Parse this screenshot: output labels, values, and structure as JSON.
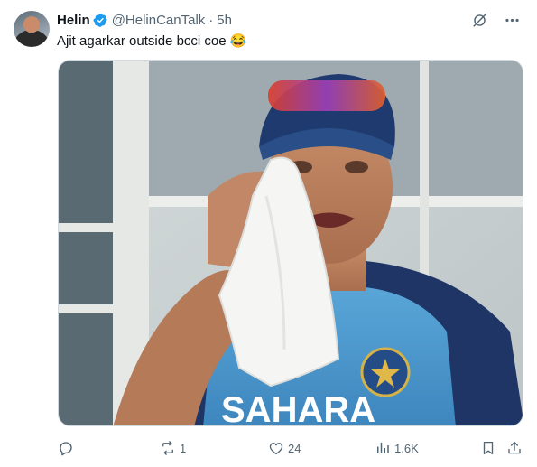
{
  "tweet": {
    "author_name": "Helin",
    "handle": "@HelinCanTalk",
    "separator": "·",
    "time": "5h",
    "text": "Ajit agarkar outside bcci coe 😂"
  },
  "media": {
    "jersey_text": "SAHARA"
  },
  "actions": {
    "replies": "",
    "reposts": "1",
    "likes": "24",
    "views": "1.6K"
  },
  "colors": {
    "verified_blue": "#1d9bf0",
    "secondary_text": "#536471"
  },
  "icons": {
    "grok": "grok-icon",
    "more": "more-icon",
    "reply": "reply-icon",
    "repost": "repost-icon",
    "like": "like-icon",
    "views": "views-icon",
    "bookmark": "bookmark-icon",
    "share": "share-icon"
  }
}
